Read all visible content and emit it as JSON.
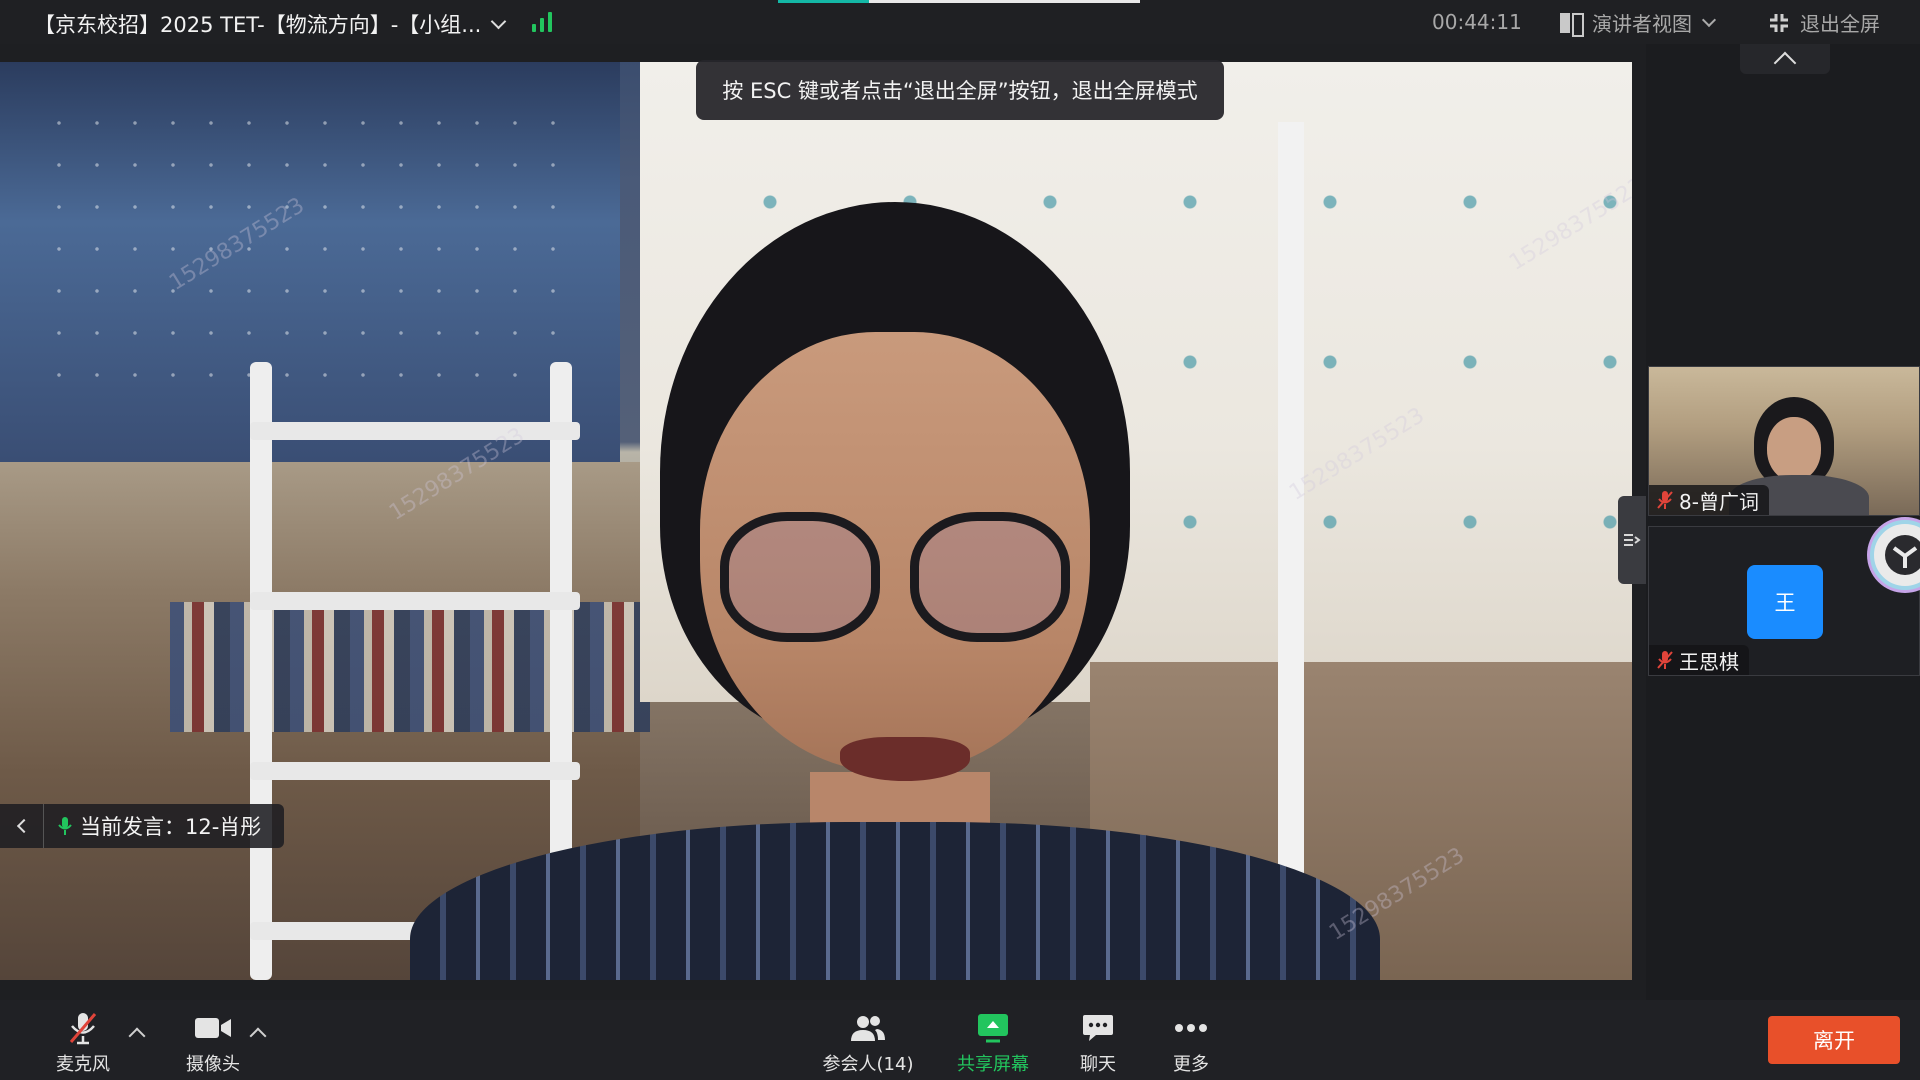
{
  "header": {
    "meeting_title": "【京东校招】2025 TET-【物流方向】-【小组...",
    "timer": "00:44:11",
    "view_mode": "演讲者视图",
    "exit_fullscreen": "退出全屏",
    "share_progress": 0.25
  },
  "overlay": {
    "esc_tip": "按 ESC 键或者点击“退出全屏”按钮，退出全屏模式",
    "current_speaker": "当前发言：12-肖彤"
  },
  "watermark_text": "15298375523",
  "participants": [
    {
      "name": "8-曾广词",
      "type": "video",
      "muted": true
    },
    {
      "name": "王思棋",
      "avatar_text": "王",
      "type": "avatar",
      "muted": true,
      "avatar_color": "#1a8cff"
    }
  ],
  "toolbar": {
    "mic_label": "麦克风",
    "camera_label": "摄像头",
    "participants_label": "参会人(14)",
    "share_label": "共享屏幕",
    "chat_label": "聊天",
    "more_label": "更多",
    "leave_label": "离开"
  },
  "colors": {
    "accent_green": "#22c55e",
    "leave_red": "#e8502a",
    "avatar_blue": "#1a8cff",
    "muted_red": "#e0443a"
  },
  "icons": [
    "signal-icon",
    "layout-icon",
    "exit-fullscreen-icon",
    "mic-muted-icon",
    "camera-icon",
    "participants-icon",
    "share-screen-icon",
    "chat-icon",
    "more-icon"
  ]
}
